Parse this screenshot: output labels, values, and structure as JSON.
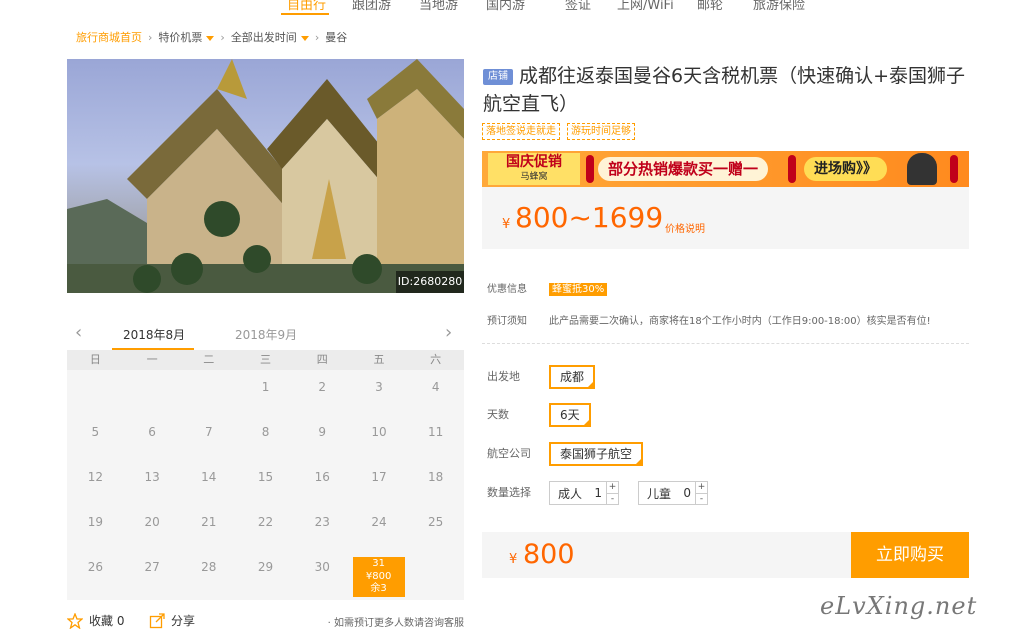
{
  "topnav": {
    "items": [
      "自由行",
      "跟团游",
      "当地游",
      "国内游",
      "签证",
      "上网/WiFi",
      "邮轮",
      "旅游保险"
    ]
  },
  "breadcrumb": {
    "home": "旅行商城首页",
    "cat": "特价机票",
    "from": "全部出发时间",
    "dest": "曼谷"
  },
  "photo": {
    "id_label": "ID:2680280"
  },
  "calendar": {
    "months": [
      "2018年8月",
      "2018年9月"
    ],
    "weekdays": [
      "日",
      "一",
      "二",
      "三",
      "四",
      "五",
      "六"
    ],
    "rows": [
      [
        "",
        "",
        "",
        "1",
        "2",
        "3",
        "4"
      ],
      [
        "5",
        "6",
        "7",
        "8",
        "9",
        "10",
        "11"
      ],
      [
        "12",
        "13",
        "14",
        "15",
        "16",
        "17",
        "18"
      ],
      [
        "19",
        "20",
        "21",
        "22",
        "23",
        "24",
        "25"
      ],
      [
        "26",
        "27",
        "28",
        "29",
        "30",
        "31",
        ""
      ]
    ],
    "available": {
      "day": "31",
      "price": "¥800",
      "remain": "余3"
    }
  },
  "actions": {
    "fav_label": "收藏 0",
    "share_label": "分享",
    "note": "· 如需预订更多人数请咨询客服"
  },
  "product": {
    "shop_tag": "店铺",
    "title": "成都往返泰国曼谷6天含税机票（快速确认+泰国狮子航空直飞）",
    "tags": [
      "落地签说走就走",
      "游玩时间足够"
    ]
  },
  "banner": {
    "logo_title": "国庆促销",
    "logo_sub": "马蜂窝",
    "text": "部分热销爆款买一赠一",
    "cta": "进场购》》"
  },
  "price": {
    "currency": "¥",
    "range": "800~1699",
    "note": "价格说明"
  },
  "info": {
    "discount_label": "优惠信息",
    "discount_badge": "蜂蜜抵30%",
    "booking_label": "预订须知",
    "booking_text": "此产品需要二次确认，商家将在18个工作小时内（工作日9:00-18:00）核实是否有位!"
  },
  "options": {
    "depart_label": "出发地",
    "depart_value": "成都",
    "days_label": "天数",
    "days_value": "6天",
    "airline_label": "航空公司",
    "airline_value": "泰国狮子航空",
    "qty_label": "数量选择",
    "adult_label": "成人",
    "adult_value": "1",
    "child_label": "儿童",
    "child_value": "0",
    "plus": "+",
    "minus": "-"
  },
  "buy": {
    "currency": "¥",
    "price": "800",
    "button": "立即购买"
  },
  "watermark": "eLvXing.net",
  "colors": {
    "accent": "#ff9d00",
    "price": "#ff6600"
  }
}
